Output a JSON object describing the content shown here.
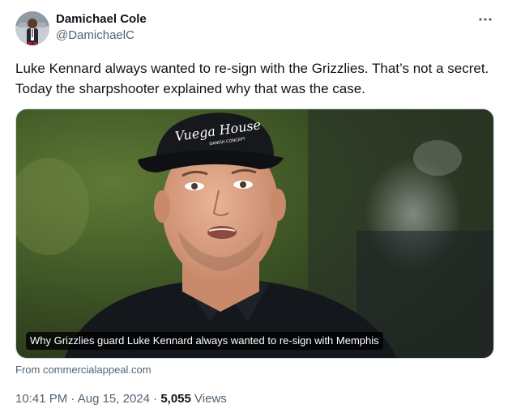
{
  "author": {
    "display_name": "Damichael Cole",
    "handle": "@DamichaelC",
    "avatar_icon": "person-avatar"
  },
  "tweet": {
    "text": "Luke Kennard always wanted to re-sign with the Grizzlies. That’s not a secret. Today the sharpshooter explained why that was the case."
  },
  "media": {
    "caption": "Why Grizzlies guard Luke Kennard always wanted to re-sign with Memphis",
    "hat_brand": "Vuega House",
    "hat_sub": "DANISH CONCEPT"
  },
  "card": {
    "source": "From commercialappeal.com"
  },
  "meta": {
    "time": "10:41 PM",
    "separator": "·",
    "date": "Aug 15, 2024",
    "views_count": "5,055",
    "views_label": "Views"
  },
  "icons": {
    "more": "more-icon"
  },
  "colors": {
    "text_primary": "#0f1419",
    "text_secondary": "#536471",
    "border": "#cfd9de"
  }
}
